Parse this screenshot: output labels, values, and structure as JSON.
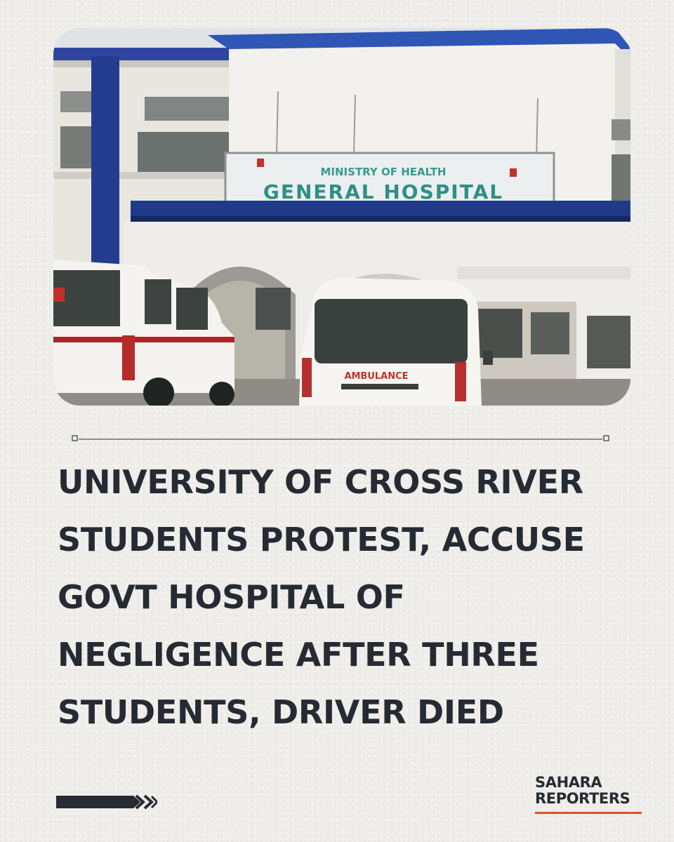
{
  "photo": {
    "sign_line1": "MINISTRY OF HEALTH",
    "sign_line2": "GENERAL HOSPITAL",
    "van_label": "AMBULANCE"
  },
  "headline": "UNIVERSITY OF CROSS RIVER STUDENTS PROTEST, ACCUSE GOVT HOSPITAL OF NEGLIGENCE AFTER THREE STUDENTS, DRIVER DIED",
  "brand": {
    "line1": "SAHARA",
    "line2": "REPORTERS",
    "accent_color": "#e0502d"
  },
  "colors": {
    "text": "#262b33",
    "background": "#efeeea"
  }
}
